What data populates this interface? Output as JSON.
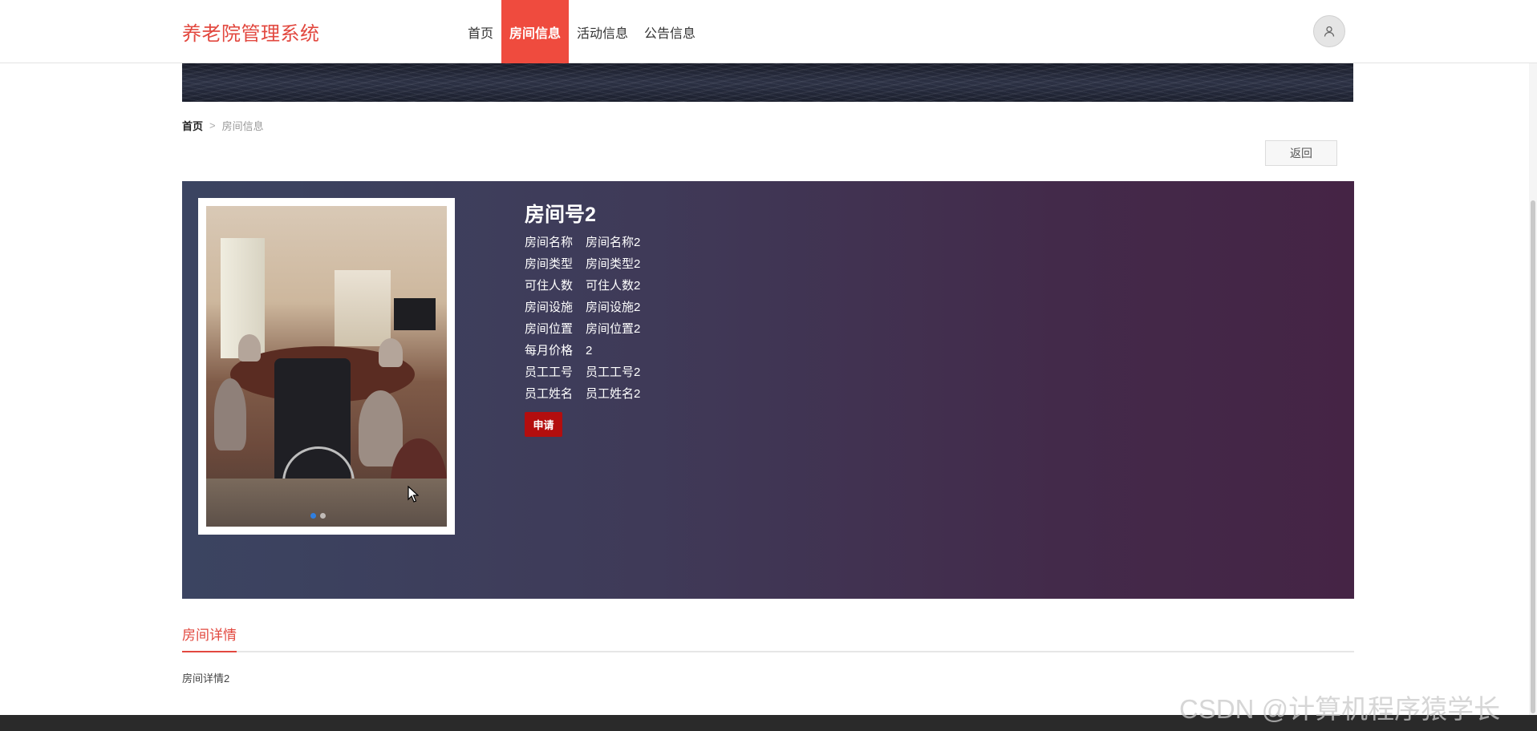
{
  "header": {
    "brand": "养老院管理系统",
    "nav": [
      {
        "label": "首页",
        "active": false
      },
      {
        "label": "房间信息",
        "active": true
      },
      {
        "label": "活动信息",
        "active": false
      },
      {
        "label": "公告信息",
        "active": false
      }
    ],
    "avatar_icon": "user-icon"
  },
  "breadcrumb": {
    "home": "首页",
    "separator": ">",
    "current": "房间信息"
  },
  "back_button": "返回",
  "room": {
    "title": "房间号2",
    "fields": [
      {
        "label": "房间名称",
        "value": "房间名称2"
      },
      {
        "label": "房间类型",
        "value": "房间类型2"
      },
      {
        "label": "可住人数",
        "value": "可住人数2"
      },
      {
        "label": "房间设施",
        "value": "房间设施2"
      },
      {
        "label": "房间位置",
        "value": "房间位置2"
      },
      {
        "label": "每月价格",
        "value": "2"
      },
      {
        "label": "员工工号",
        "value": "员工工号2"
      },
      {
        "label": "员工姓名",
        "value": "员工姓名2"
      }
    ],
    "apply_button": "申请"
  },
  "detail": {
    "tab": "房间详情",
    "content": "房间详情2"
  },
  "watermark": "CSDN @计算机程序猿学长",
  "colors": {
    "brand": "#e2483f",
    "nav_active_bg": "#ef4b3e",
    "apply_button": "#b30e0e"
  }
}
